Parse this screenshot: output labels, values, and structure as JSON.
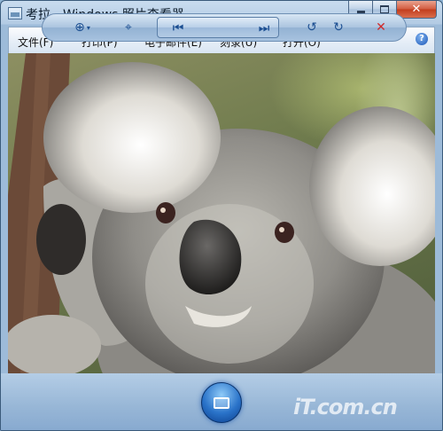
{
  "window": {
    "title": "考拉 - Windows 照片查看器"
  },
  "menu": {
    "items": [
      {
        "label": "文件(F)"
      },
      {
        "label": "打印(P)"
      },
      {
        "label": "电子邮件(E)"
      },
      {
        "label": "刻录(U)"
      },
      {
        "label": "打开(O)"
      }
    ],
    "help_glyph": "?"
  },
  "photo": {
    "subject": "koala"
  },
  "toolbar": {
    "icons": [
      "zoom-icon",
      "actual-size-icon",
      "previous-icon",
      "slideshow-icon",
      "next-icon",
      "rotate-counterclockwise-icon",
      "rotate-clockwise-icon",
      "delete-icon"
    ],
    "watermark": "iT.com.cn"
  },
  "colors": {
    "accent": "#1b4e91",
    "delete": "#d02a2a",
    "close_button": "#c23c1d"
  }
}
